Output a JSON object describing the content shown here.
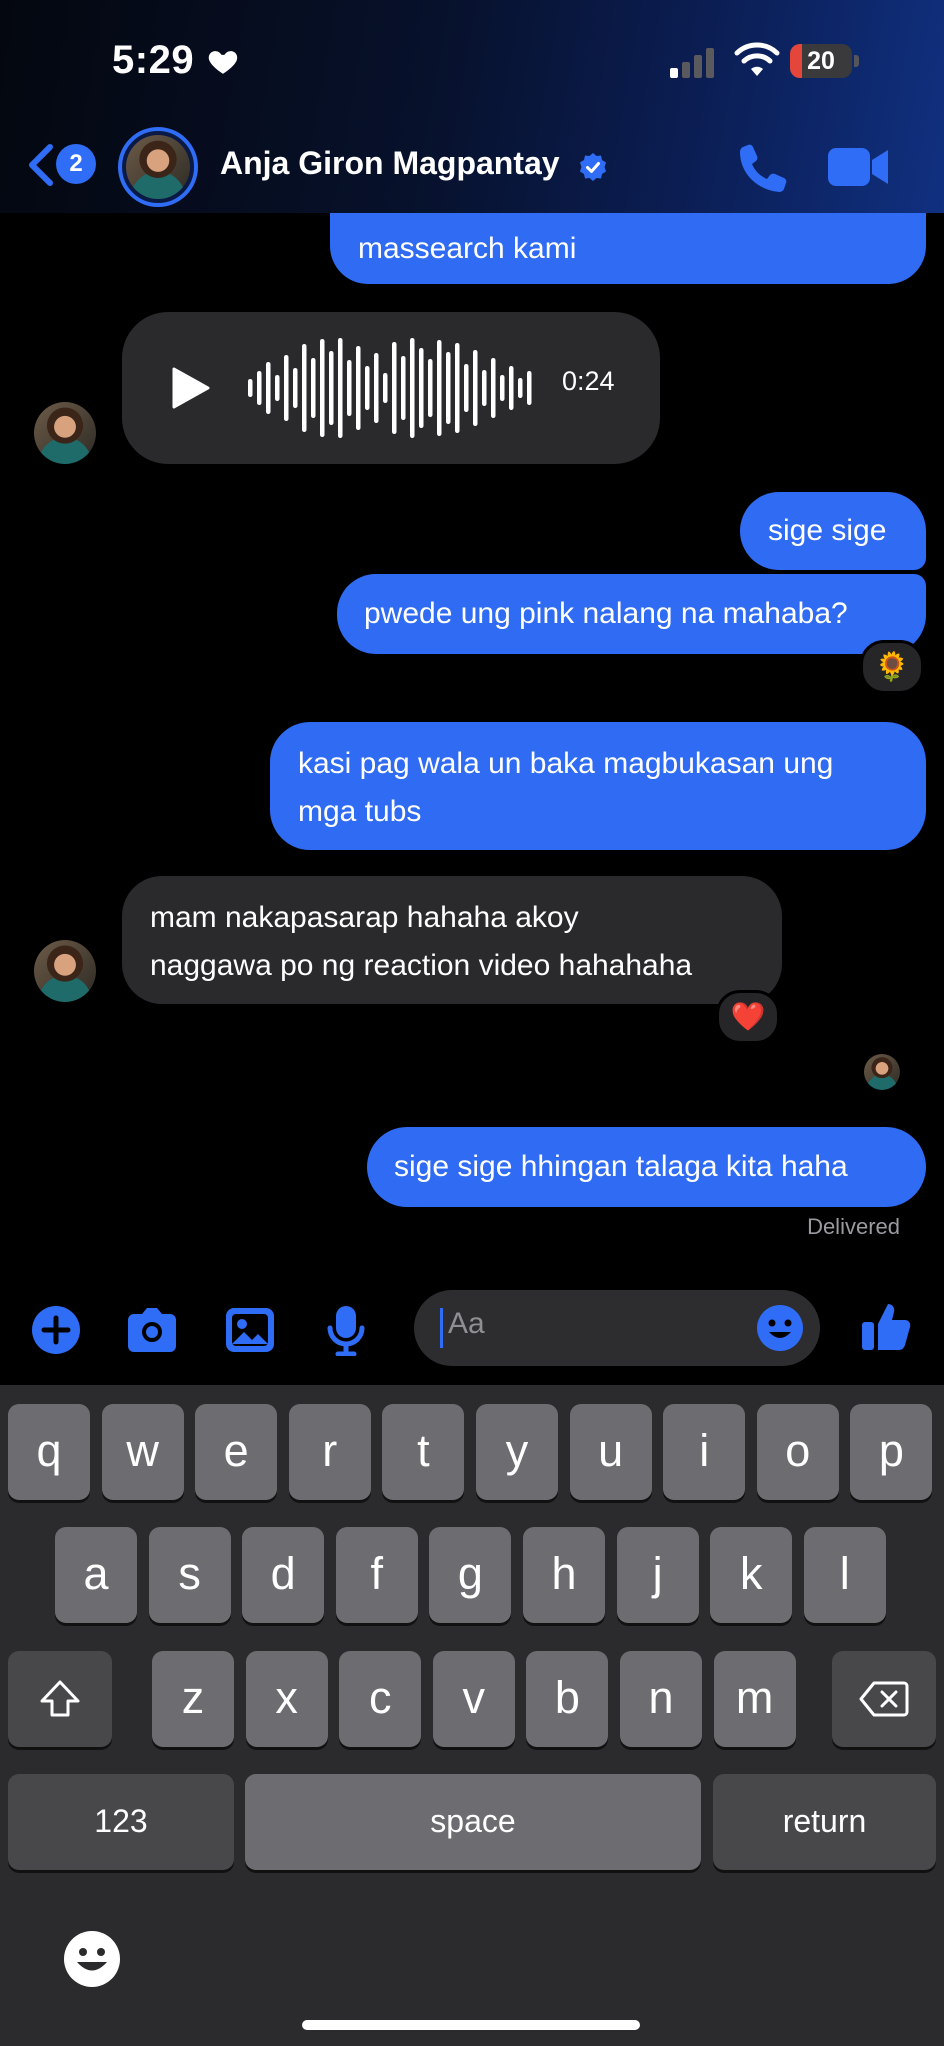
{
  "status_bar": {
    "time": "5:29",
    "battery_level": "20",
    "battery_fraction": 0.2,
    "battery_color": "#e5463b"
  },
  "header": {
    "back_unread_count": "2",
    "contact_name": "Anja Giron Magpantay",
    "verified_icon": "verified-badge-icon",
    "call_icon": "phone-icon",
    "video_icon": "video-camera-icon"
  },
  "conversation": {
    "msg_top_partial": "massearch kami",
    "voice_message_duration": "0:24",
    "msg_sige_sige": "sige sige",
    "msg_pwede": "pwede ung pink nalang na mahaba?",
    "reaction_sunflower": "🌻",
    "msg_kasi_line1": "kasi pag wala un baka magbukasan ung",
    "msg_kasi_line2": "mga tubs",
    "msg_mam_line1": "mam nakapasarap hahaha akoy",
    "msg_mam_line2": "naggawa po ng reaction video hahahaha",
    "reaction_heart": "❤️",
    "msg_last": "sige sige hhingan talaga kita haha",
    "delivered_status": "Delivered"
  },
  "composer": {
    "placeholder": "Aa",
    "icons": [
      "plus-icon",
      "camera-icon",
      "gallery-icon",
      "microphone-icon",
      "emoji-icon",
      "thumbs-up-icon"
    ]
  },
  "keyboard": {
    "row1": [
      "q",
      "w",
      "e",
      "r",
      "t",
      "y",
      "u",
      "i",
      "o",
      "p"
    ],
    "row2": [
      "a",
      "s",
      "d",
      "f",
      "g",
      "h",
      "j",
      "k",
      "l"
    ],
    "row3": [
      "z",
      "x",
      "c",
      "v",
      "b",
      "n",
      "m"
    ],
    "numbers_key": "123",
    "space_key": "space",
    "return_key": "return"
  },
  "colors": {
    "accent": "#2f6df6",
    "outgoing_bubble": "#2f6bf3",
    "incoming_bubble": "#2a2a2c"
  }
}
